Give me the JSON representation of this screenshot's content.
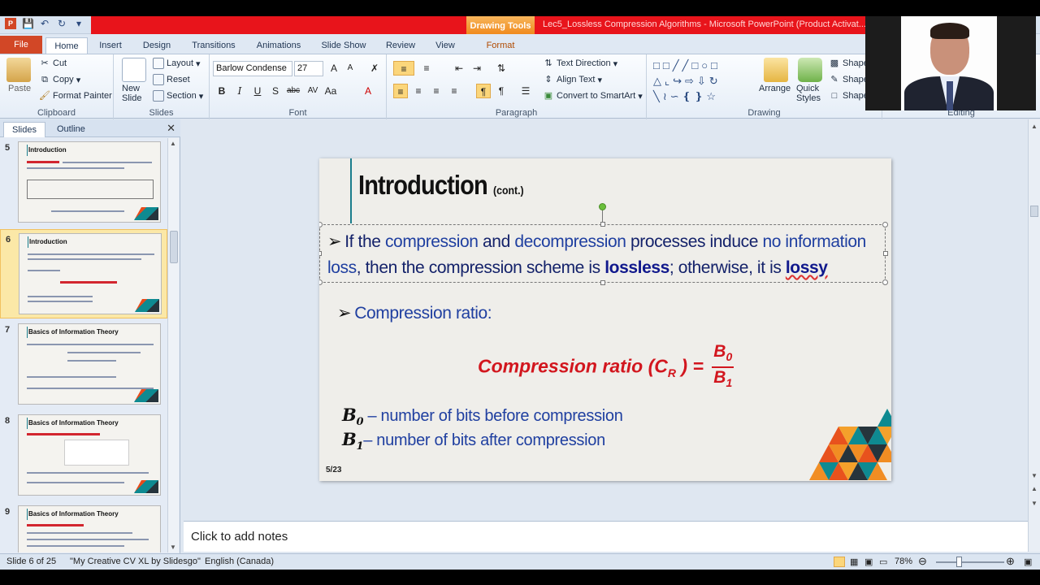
{
  "window": {
    "title": "Lec5_Lossless Compression Algorithms - Microsoft PowerPoint (Product Activat...",
    "contextual_tab": "Drawing Tools"
  },
  "tabs": [
    "File",
    "Home",
    "Insert",
    "Design",
    "Transitions",
    "Animations",
    "Slide Show",
    "Review",
    "View",
    "Format"
  ],
  "ribbon": {
    "clipboard": {
      "paste": "Paste",
      "cut": "Cut",
      "copy": "Copy",
      "format_painter": "Format Painter",
      "label": "Clipboard"
    },
    "slides": {
      "new_slide": "New Slide",
      "layout": "Layout",
      "reset": "Reset",
      "section": "Section",
      "label": "Slides"
    },
    "font": {
      "family": "Barlow Condense",
      "size": "27",
      "label": "Font"
    },
    "paragraph": {
      "text_direction": "Text Direction",
      "align_text": "Align Text",
      "convert_smartart": "Convert to SmartArt",
      "label": "Paragraph"
    },
    "drawing": {
      "arrange": "Arrange",
      "quick_styles": "Quick Styles",
      "shape1": "Shape",
      "shape2": "Shape",
      "shape3": "Shape",
      "label": "Drawing",
      "editing": "Editing"
    }
  },
  "left_panel": {
    "tabs": [
      "Slides",
      "Outline"
    ],
    "thumbs": [
      {
        "num": "5",
        "title": "Introduction"
      },
      {
        "num": "6",
        "title": "Introduction"
      },
      {
        "num": "7",
        "title": "Basics of Information  Theory"
      },
      {
        "num": "8",
        "title": "Basics of Information  Theory"
      },
      {
        "num": "9",
        "title": "Basics of Information  Theory"
      }
    ]
  },
  "slide": {
    "title": "Introduction",
    "title_suffix": "(cont.)",
    "para": {
      "p1": "If the",
      "p2": "compression",
      "p3": "and",
      "p4": "decompression",
      "p5": "processes induce",
      "p6": "no information loss",
      "p7": ", then the compression scheme is",
      "p8": "lossless",
      "p9": "; otherwise, it is",
      "p10": "lossy"
    },
    "sub": "Compression ratio:",
    "formula_label": "Compression ratio (C",
    "formula_sub": "R",
    "formula_close": ") =",
    "num": "B",
    "num_sub": "0",
    "den": "B",
    "den_sub": "1",
    "def1_sym": "B",
    "def1_sub": "0",
    "def1_text": " – number of bits before compression",
    "def2_sym": "B",
    "def2_sub": "1",
    "def2_text": "– number of bits after compression",
    "number": "5/23"
  },
  "notes": {
    "placeholder": "Click to add notes"
  },
  "status": {
    "slide": "Slide 6 of 25",
    "theme": "\"My Creative CV XL by Slidesgo\"",
    "language": "English (Canada)",
    "zoom": "78%"
  },
  "colors": {
    "accent_red": "#e8141b",
    "file_tab": "#d24726",
    "title_teal": "#1b7d8c",
    "formula_red": "#d2161e",
    "text_blue": "#1f3fa0"
  }
}
